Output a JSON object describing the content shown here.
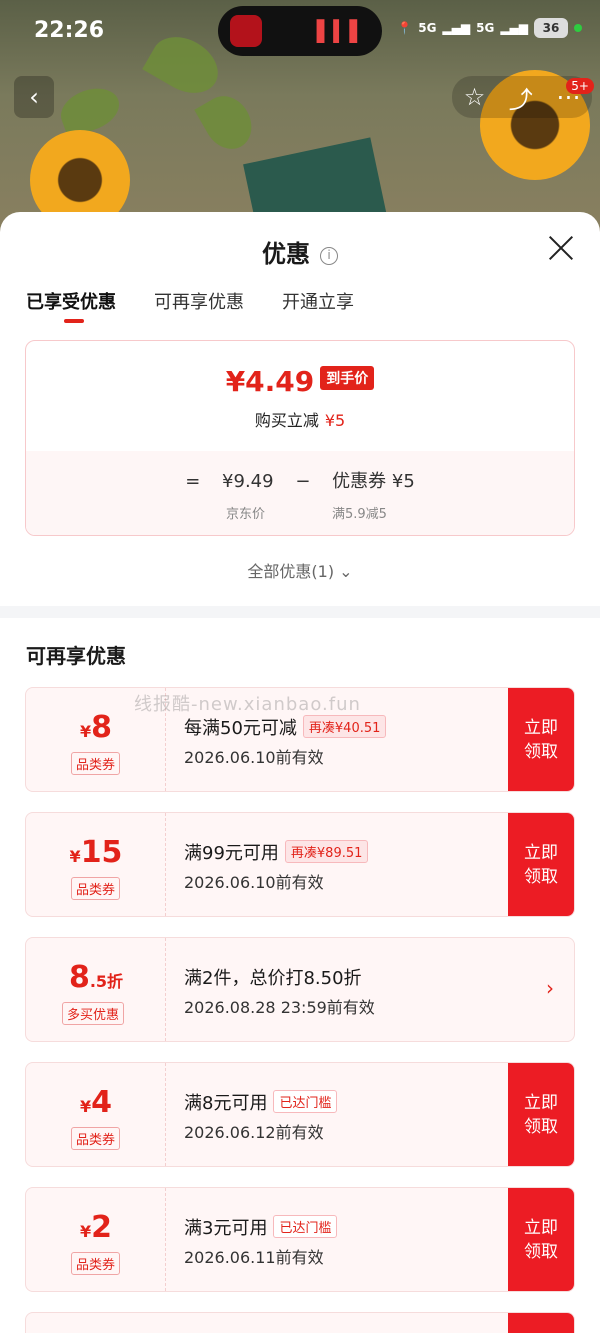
{
  "status": {
    "time": "22:26",
    "net1": "5G",
    "net2": "5G",
    "battery": "36"
  },
  "nav": {
    "badge": "5+"
  },
  "sheet": {
    "title": "优惠",
    "tabs": [
      "已享受优惠",
      "可再享优惠",
      "开通立享"
    ],
    "price": {
      "final": "¥4.49",
      "final_tag": "到手价",
      "reduce_label": "购买立减",
      "reduce_amount": "¥5",
      "eq": "=",
      "original": "¥9.49",
      "minus": "−",
      "coupon": "优惠券 ¥5",
      "original_label": "京东价",
      "coupon_label": "满5.9减5"
    },
    "all_promos": "全部优惠(1)",
    "section_title": "可再享优惠"
  },
  "watermark": "线报酷-new.xianbao.fun",
  "cards": [
    {
      "currency": "¥",
      "value": "8",
      "type": "品类券",
      "line1": "每满50元可减",
      "chip": "再凑¥40.51",
      "line2": "2026.06.10前有效",
      "action1": "立即",
      "action2": "领取"
    },
    {
      "currency": "¥",
      "value": "15",
      "type": "品类券",
      "line1": "满99元可用",
      "chip": "再凑¥89.51",
      "line2": "2026.06.10前有效",
      "action1": "立即",
      "action2": "领取"
    },
    {
      "value": "8",
      "value_suffix": ".5折",
      "type": "多买优惠",
      "line1": "满2件，总价打8.50折",
      "line2": "2026.08.28 23:59前有效"
    },
    {
      "currency": "¥",
      "value": "4",
      "type": "品类券",
      "line1": "满8元可用",
      "chip": "已达门槛",
      "line2": "2026.06.12前有效",
      "action1": "立即",
      "action2": "领取"
    },
    {
      "currency": "¥",
      "value": "2",
      "type": "品类券",
      "line1": "满3元可用",
      "chip": "已达门槛",
      "line2": "2026.06.11前有效",
      "action1": "立即",
      "action2": "领取"
    }
  ]
}
